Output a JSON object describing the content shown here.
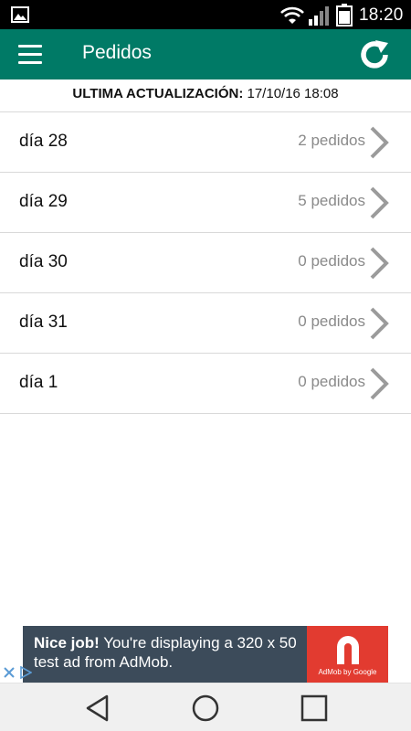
{
  "status_bar": {
    "time": "18:20",
    "icons": [
      "gallery-icon",
      "wifi-icon",
      "signal-icon",
      "battery-icon"
    ]
  },
  "app_bar": {
    "title": "Pedidos",
    "menu_icon": "hamburger-menu-icon",
    "refresh_icon": "refresh-icon",
    "color": "#007a66"
  },
  "last_update": {
    "label": "ULTIMA ACTUALIZACIÓN:",
    "value": "17/10/16 18:08"
  },
  "days": [
    {
      "label": "día 28",
      "count": "2 pedidos"
    },
    {
      "label": "día 29",
      "count": "5 pedidos"
    },
    {
      "label": "día 30",
      "count": "0 pedidos"
    },
    {
      "label": "día 31",
      "count": "0 pedidos"
    },
    {
      "label": "día 1",
      "count": "0 pedidos"
    }
  ],
  "ad": {
    "headline": "Nice job!",
    "body": "You're displaying a 320 x 50 test ad from AdMob.",
    "brand": "AdMob by Google",
    "background": "#3c4b5a",
    "logo_background": "#e23b30"
  },
  "nav_bar": {
    "icons": [
      "back-icon",
      "home-icon",
      "recents-icon"
    ]
  }
}
